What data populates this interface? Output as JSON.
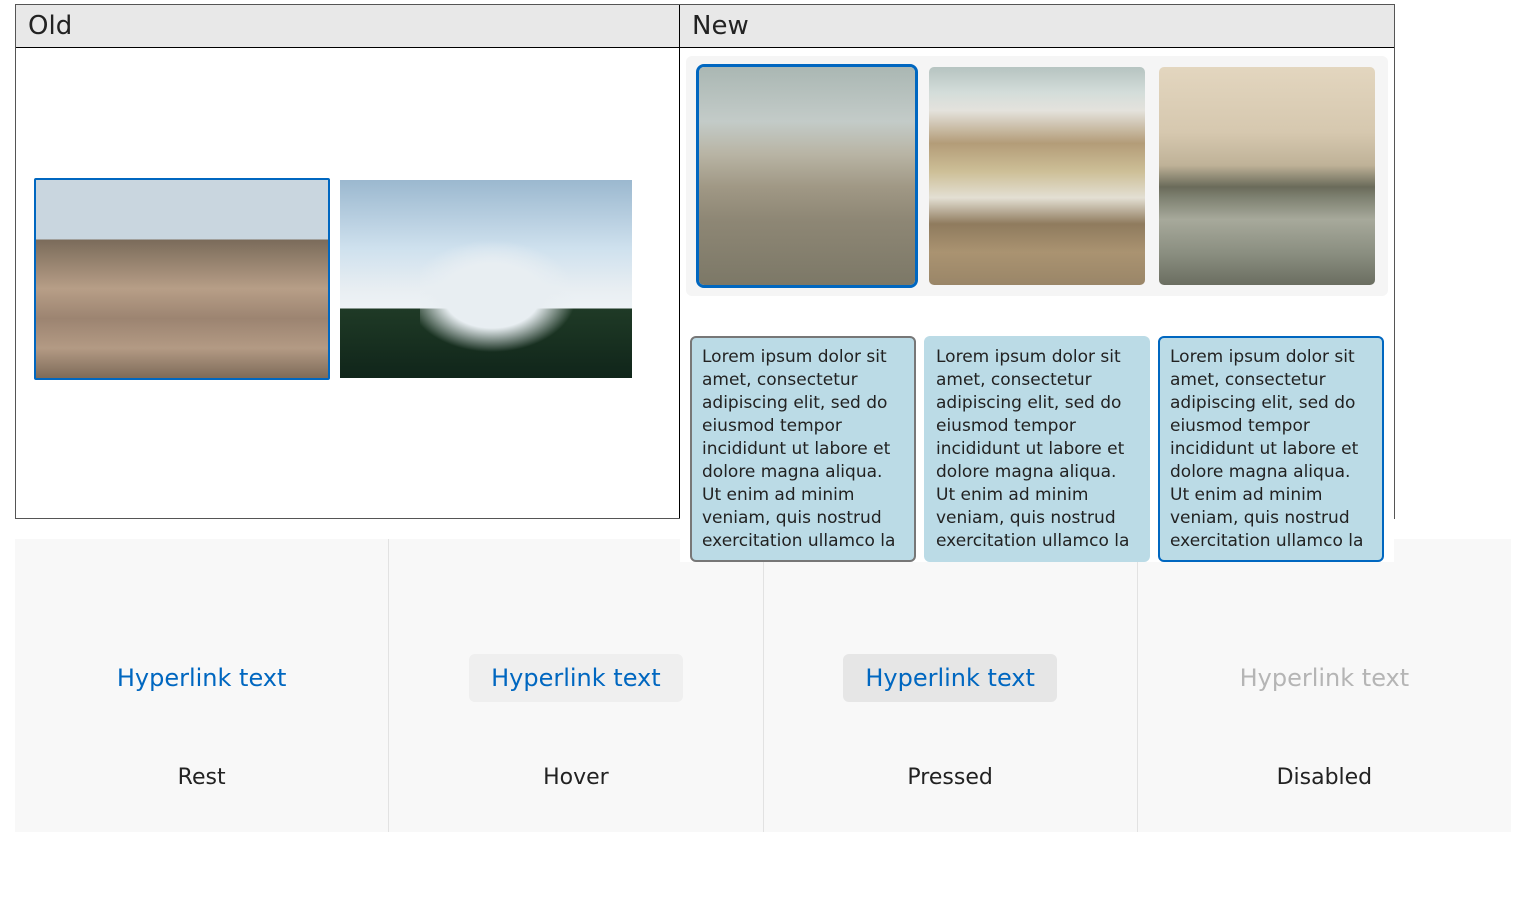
{
  "comparison": {
    "old_label": "Old",
    "new_label": "New",
    "old_images": [
      {
        "name": "gateway",
        "selected": true
      },
      {
        "name": "mountain",
        "selected": false
      }
    ],
    "new_images": [
      {
        "name": "cityscape",
        "selected": true
      },
      {
        "name": "houses",
        "selected": false
      },
      {
        "name": "river",
        "selected": false
      }
    ],
    "lorem_text": "Lorem ipsum dolor sit amet, consectetur adipiscing elit, sed do eiusmod tempor incididunt ut labore et dolore magna aliqua. Ut enim ad minim veniam, quis nostrud exercitation ullamco la",
    "lorem_cards": [
      {
        "border": "gray"
      },
      {
        "border": "none"
      },
      {
        "border": "blue"
      }
    ]
  },
  "hyperlink_states": {
    "link_text": "Hyperlink text",
    "states": [
      {
        "key": "rest",
        "label": "Rest"
      },
      {
        "key": "hover",
        "label": "Hover"
      },
      {
        "key": "pressed",
        "label": "Pressed"
      },
      {
        "key": "disabled",
        "label": "Disabled"
      }
    ]
  }
}
